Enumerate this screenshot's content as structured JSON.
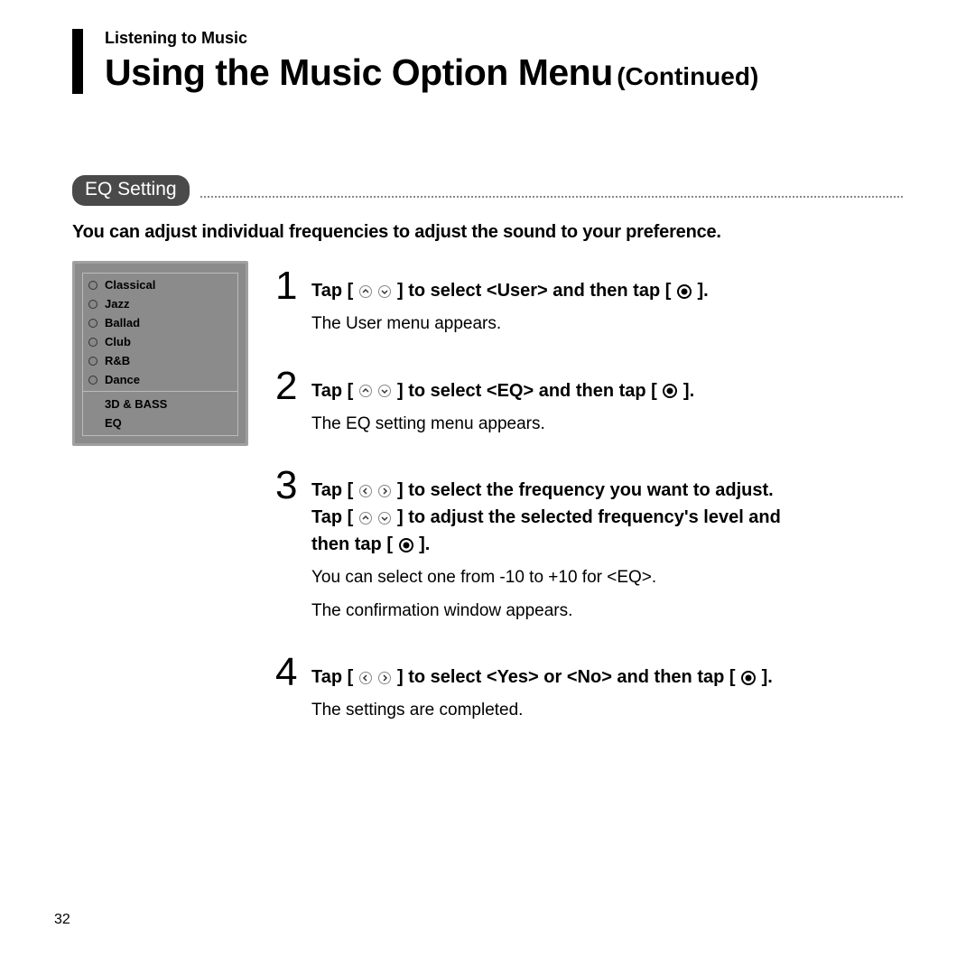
{
  "section_label": "Listening to Music",
  "main_title": "Using the Music Option Menu",
  "title_sub": "(Continued)",
  "badge": "EQ Setting",
  "intro": "You can adjust individual frequencies to adjust the sound to your preference.",
  "presets": [
    "Classical",
    "Jazz",
    "Ballad",
    "Club",
    "R&B",
    "Dance"
  ],
  "sub_items": [
    "3D & BASS",
    "EQ"
  ],
  "steps": [
    {
      "num": "1",
      "bold_parts": [
        "Tap [",
        "] to select <User> and then tap [",
        "]."
      ],
      "icon_set": "updown",
      "notes": [
        "The User menu appears."
      ]
    },
    {
      "num": "2",
      "bold_parts": [
        "Tap [",
        "] to select <EQ> and then tap [",
        "]."
      ],
      "icon_set": "updown",
      "notes": [
        "The EQ setting menu appears."
      ]
    },
    {
      "num": "3",
      "lines": [
        {
          "parts": [
            "Tap [",
            "] to select the frequency you want to adjust."
          ],
          "icon_set": "leftright"
        },
        {
          "parts": [
            "Tap [",
            "] to adjust the selected frequency's level and"
          ],
          "icon_set": "updown"
        },
        {
          "parts": [
            "then tap [",
            "]."
          ],
          "icon_set": "center"
        }
      ],
      "notes": [
        "You can select one from -10 to +10 for <EQ>.",
        "The confirmation window appears."
      ]
    },
    {
      "num": "4",
      "bold_parts": [
        "Tap [",
        "] to select <Yes> or <No> and then tap [",
        "]."
      ],
      "icon_set": "leftright",
      "notes": [
        "The settings are completed."
      ]
    }
  ],
  "page_number": "32"
}
